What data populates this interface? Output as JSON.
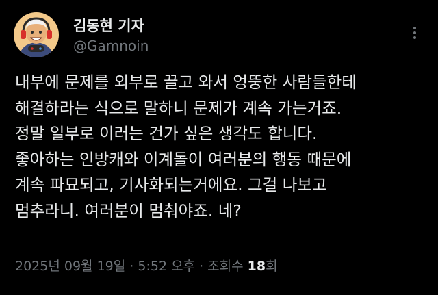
{
  "author": {
    "display_name": "김동현 기자",
    "handle": "@Gamnoin",
    "avatar_icon": "cartoon-gamer-avatar"
  },
  "menu": {
    "icon": "more-options-icon"
  },
  "tweet": {
    "lines": [
      "내부에 문제를 외부로 끌고 와서 엉뚱한 사람들한테",
      "해결하라는 식으로 말하니 문제가 계속 가는거죠.",
      "정말 일부로 이러는 건가 싶은 생각도 합니다.",
      "좋아하는 인방캐와 이계돌이 여러분의 행동 때문에",
      "계속 파묘되고, 기사화되는거에요. 그걸 나보고",
      "멈추라니. 여러분이 멈춰야죠. 네?"
    ]
  },
  "meta": {
    "date": "2025년 09월 19일",
    "sep1": " · ",
    "time": "5:52 오후",
    "sep2": " · ",
    "views_label": "조회수 ",
    "views_count": "18",
    "views_unit": "회"
  },
  "colors": {
    "background": "#000000",
    "primary_text": "#e7e9ea",
    "secondary_text": "#71767b",
    "avatar_bg": "#f3c98a"
  }
}
